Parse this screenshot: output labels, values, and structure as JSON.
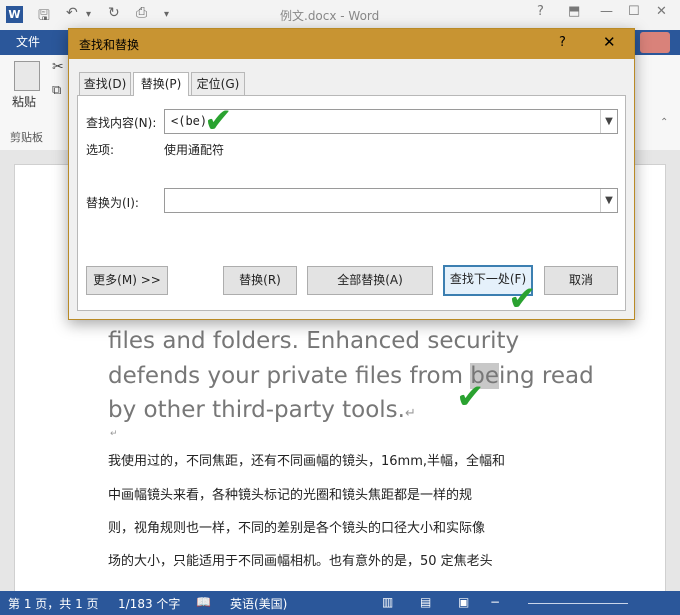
{
  "app": {
    "icon_letter": "W",
    "title": "例文.docx - Word",
    "file_tab": "文件",
    "quick_access_icons": [
      "save-icon",
      "undo-icon",
      "redo-icon",
      "print-preview-icon",
      "customize-icon"
    ],
    "window_controls": [
      "help-icon",
      "ribbon-display-icon",
      "minimize-icon",
      "maximize-icon",
      "close-icon"
    ]
  },
  "ribbon": {
    "paste_label": "粘贴",
    "group_label": "剪贴板"
  },
  "dialog": {
    "title": "查找和替换",
    "help": "?",
    "close": "✕",
    "tabs": [
      {
        "label": "查找(D)",
        "active": false
      },
      {
        "label": "替换(P)",
        "active": true
      },
      {
        "label": "定位(G)",
        "active": false
      }
    ],
    "find_label": "查找内容(N):",
    "find_value": "<(be)",
    "options_label": "选项:",
    "options_value": "使用通配符",
    "replace_label": "替换为(I):",
    "replace_value": "",
    "buttons": {
      "more": "更多(M) >>",
      "replace": "替换(R)",
      "replace_all": "全部替换(A)",
      "find_next": "查找下一处(F)",
      "cancel": "取消"
    }
  },
  "document": {
    "english_lines": [
      "files and folders. Enhanced security",
      "defends your private files from ",
      "by other third-party tools."
    ],
    "highlight_word": "be",
    "after_highlight": "ing read",
    "chinese_lines": [
      "我使用过的，不同焦距，还有不同画幅的镜头，16mm,半幅，全幅和",
      "中画幅镜头来看，各种镜头标记的光圈和镜头焦距都是一样的规",
      "则，视角规则也一样，不同的差别是各个镜头的口径大小和实际像",
      "场的大小，只能适用于不同画幅相机。也有意外的是，50 定焦老头"
    ]
  },
  "statusbar": {
    "page": "第 1 页，共 1 页",
    "words": "1/183 个字",
    "language": "英语(美国)"
  },
  "colors": {
    "word_blue": "#2b579a",
    "dialog_title_bg": "#c89432",
    "check_green": "#2aa230"
  }
}
